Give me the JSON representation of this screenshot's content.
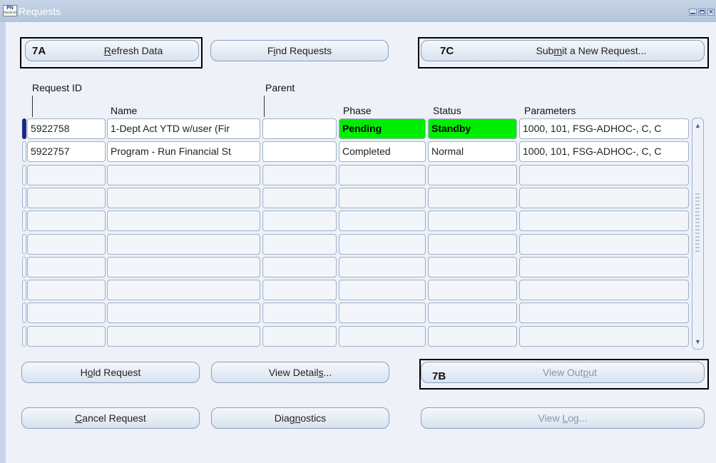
{
  "window": {
    "title": "Requests",
    "icon_text": "PN",
    "icon_sub": "Applications"
  },
  "top_buttons": {
    "refresh": "Refresh Data",
    "find": "Find Requests",
    "submit": "Submit a New Request..."
  },
  "callouts": {
    "a": "7A",
    "b": "7B",
    "c": "7C"
  },
  "columns": {
    "request_id": "Request ID",
    "name": "Name",
    "parent": "Parent",
    "phase": "Phase",
    "status": "Status",
    "parameters": "Parameters"
  },
  "rows": [
    {
      "request_id": "5922758",
      "name": "1-Dept Act YTD w/user (Fir",
      "parent": "",
      "phase": "Pending",
      "status": "Standby",
      "parameters": "1000, 101, FSG-ADHOC-, C, C"
    },
    {
      "request_id": "5922757",
      "name": "Program - Run Financial St",
      "parent": "",
      "phase": "Completed",
      "status": "Normal",
      "parameters": "1000, 101, FSG-ADHOC-, C, C"
    }
  ],
  "bottom_buttons": {
    "hold": "Hold Request",
    "view_details": "View Details...",
    "view_output": "View Output",
    "cancel": "Cancel Request",
    "diagnostics": "Diagnostics",
    "view_log": "View Log..."
  },
  "colors": {
    "pending_highlight": "#00ee00",
    "title_bar": "#b3c4dc"
  },
  "icons": [
    "minimize-icon",
    "maximize-icon",
    "close-icon",
    "scroll-up-icon",
    "scroll-down-icon"
  ]
}
